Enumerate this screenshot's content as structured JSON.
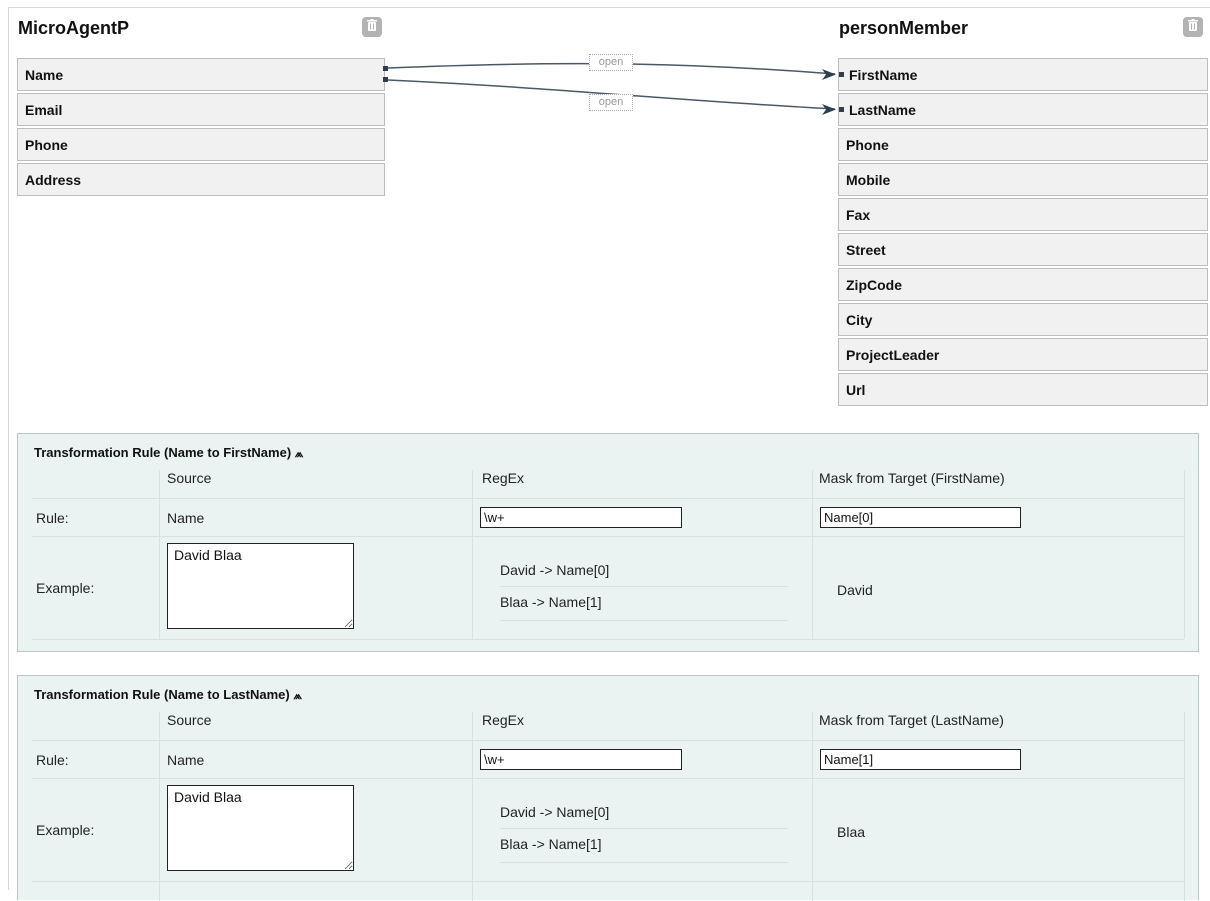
{
  "mapping": {
    "source_entity": {
      "title": "MicroAgentP",
      "delete_icon": "trash-icon",
      "fields": [
        "Name",
        "Email",
        "Phone",
        "Address"
      ]
    },
    "target_entity": {
      "title": "personMember",
      "delete_icon": "trash-icon",
      "fields": [
        "FirstName",
        "LastName",
        "Phone",
        "Mobile",
        "Fax",
        "Street",
        "ZipCode",
        "City",
        "ProjectLeader",
        "Url"
      ]
    },
    "connections": [
      {
        "from": "Name",
        "to": "FirstName",
        "label": "open"
      },
      {
        "from": "Name",
        "to": "LastName",
        "label": "open"
      }
    ]
  },
  "rules": [
    {
      "title": "Transformation Rule (Name to FirstName)",
      "collapse_icon": "double-chevron-up-icon",
      "headers": {
        "source": "Source",
        "regex": "RegEx",
        "mask": "Mask from Target (FirstName)"
      },
      "rule_label": "Rule:",
      "source_value": "Name",
      "regex_value": "\\w+",
      "mask_value": "Name[0]",
      "example_label": "Example:",
      "example_text": "David Blaa",
      "matches": [
        "David -> Name[0]",
        "Blaa -> Name[1]"
      ],
      "result": "David"
    },
    {
      "title": "Transformation Rule (Name to LastName)",
      "collapse_icon": "double-chevron-up-icon",
      "headers": {
        "source": "Source",
        "regex": "RegEx",
        "mask": "Mask from Target (LastName)"
      },
      "rule_label": "Rule:",
      "source_value": "Name",
      "regex_value": "\\w+",
      "mask_value": "Name[1]",
      "example_label": "Example:",
      "example_text": "David Blaa",
      "matches": [
        "David -> Name[0]",
        "Blaa -> Name[1]"
      ],
      "result": "Blaa"
    }
  ]
}
